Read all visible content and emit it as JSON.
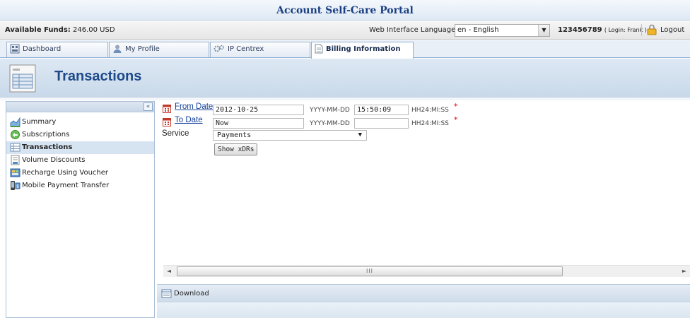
{
  "app": {
    "title": "Account Self-Care Portal"
  },
  "infobar": {
    "funds_label": "Available Funds:",
    "funds_value": "246.00 USD",
    "language_label": "Web Interface Language:",
    "language_value": "en - English",
    "account_id": "123456789",
    "login_text": "( Login: Frank )",
    "logout_label": "Logout"
  },
  "tabs": [
    {
      "label": "Dashboard",
      "icon": "dashboard-icon",
      "active": false
    },
    {
      "label": "My Profile",
      "icon": "user-icon",
      "active": false
    },
    {
      "label": "IP Centrex",
      "icon": "gear-icon",
      "active": false
    },
    {
      "label": "Billing Information",
      "icon": "document-icon",
      "active": true
    }
  ],
  "page": {
    "title": "Transactions",
    "icon": "transactions-icon"
  },
  "sidebar": {
    "collapse_label": "«",
    "items": [
      {
        "label": "Summary",
        "icon": "chart-icon",
        "active": false
      },
      {
        "label": "Subscriptions",
        "icon": "subscriptions-icon",
        "active": false
      },
      {
        "label": "Transactions",
        "icon": "transactions-icon",
        "active": true
      },
      {
        "label": "Volume Discounts",
        "icon": "discount-icon",
        "active": false
      },
      {
        "label": "Recharge Using Voucher",
        "icon": "voucher-icon",
        "active": false
      },
      {
        "label": "Mobile Payment Transfer",
        "icon": "mobile-payment-icon",
        "active": false
      }
    ]
  },
  "form": {
    "from_date_label": "From Date",
    "from_date_value": "2012-10-25",
    "from_date_format": "YYYY-MM-DD",
    "from_time_value": "15:50:09",
    "from_time_format": "HH24:MI:SS",
    "to_date_label": "To Date",
    "to_date_value": "Now",
    "to_date_format": "YYYY-MM-DD",
    "to_time_value": "",
    "to_time_format": "HH24:MI:SS",
    "required_mark": "*",
    "service_label": "Service",
    "service_value": "Payments",
    "show_button": "Show xDRs"
  },
  "scrollbar": {
    "left_arrow": "◄",
    "right_arrow": "►",
    "grip": "III"
  },
  "bottombar": {
    "download_label": "Download"
  },
  "colors": {
    "accent": "#1a3f82",
    "title_blue": "#1e4a8a",
    "link": "#14409a",
    "required": "#dd0000"
  }
}
